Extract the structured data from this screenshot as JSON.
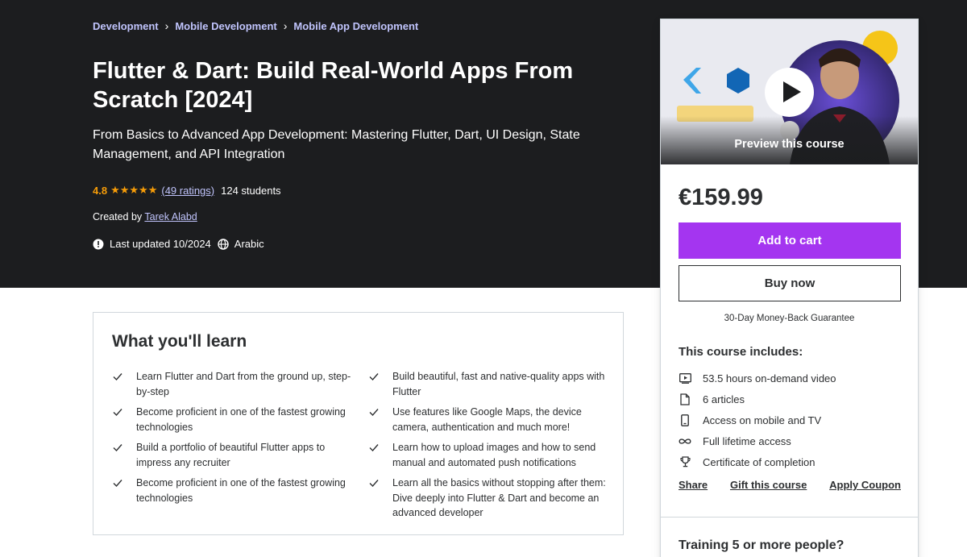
{
  "breadcrumb": [
    {
      "label": "Development"
    },
    {
      "label": "Mobile Development"
    },
    {
      "label": "Mobile App Development"
    }
  ],
  "course": {
    "title": "Flutter & Dart: Build Real-World Apps From Scratch [2024]",
    "subtitle": "From Basics to Advanced App Development: Mastering Flutter, Dart, UI Design, State Management, and API Integration",
    "rating": "4.8",
    "stars_shown": 5,
    "ratings_text": "(49 ratings)",
    "students_text": "124 students",
    "created_by_prefix": "Created by",
    "author": "Tarek Alabd",
    "last_updated": "Last updated 10/2024",
    "language": "Arabic"
  },
  "sidebar": {
    "preview_label": "Preview this course",
    "price": "€159.99",
    "add_to_cart": "Add to cart",
    "buy_now": "Buy now",
    "guarantee": "30-Day Money-Back Guarantee",
    "includes_title": "This course includes:",
    "includes": [
      {
        "icon": "video-icon",
        "text": "53.5 hours on-demand video"
      },
      {
        "icon": "file-icon",
        "text": "6 articles"
      },
      {
        "icon": "mobile-icon",
        "text": "Access on mobile and TV"
      },
      {
        "icon": "infinity-icon",
        "text": "Full lifetime access"
      },
      {
        "icon": "trophy-icon",
        "text": "Certificate of completion"
      }
    ],
    "links": {
      "share": "Share",
      "gift": "Gift this course",
      "coupon": "Apply Coupon"
    },
    "training_title": "Training 5 or more people?"
  },
  "learn": {
    "title": "What you'll learn",
    "left": [
      "Learn Flutter and Dart from the ground up, step-by-step",
      "Become proficient in one of the fastest growing technologies",
      "Build a portfolio of beautiful Flutter apps to impress any recruiter",
      "Become proficient in one of the fastest growing technologies"
    ],
    "right": [
      "Build beautiful, fast and native-quality apps with Flutter",
      "Use features like Google Maps, the device camera, authentication and much more!",
      "Learn how to upload images and how to send manual and automated push notifications",
      "Learn all the basics without stopping after them: Dive deeply into Flutter & Dart and become an advanced developer"
    ]
  },
  "colors": {
    "hero_bg": "#1c1d1f",
    "link": "#c0c4fc",
    "star": "#f69c08",
    "cart_purple": "#a435f0"
  }
}
